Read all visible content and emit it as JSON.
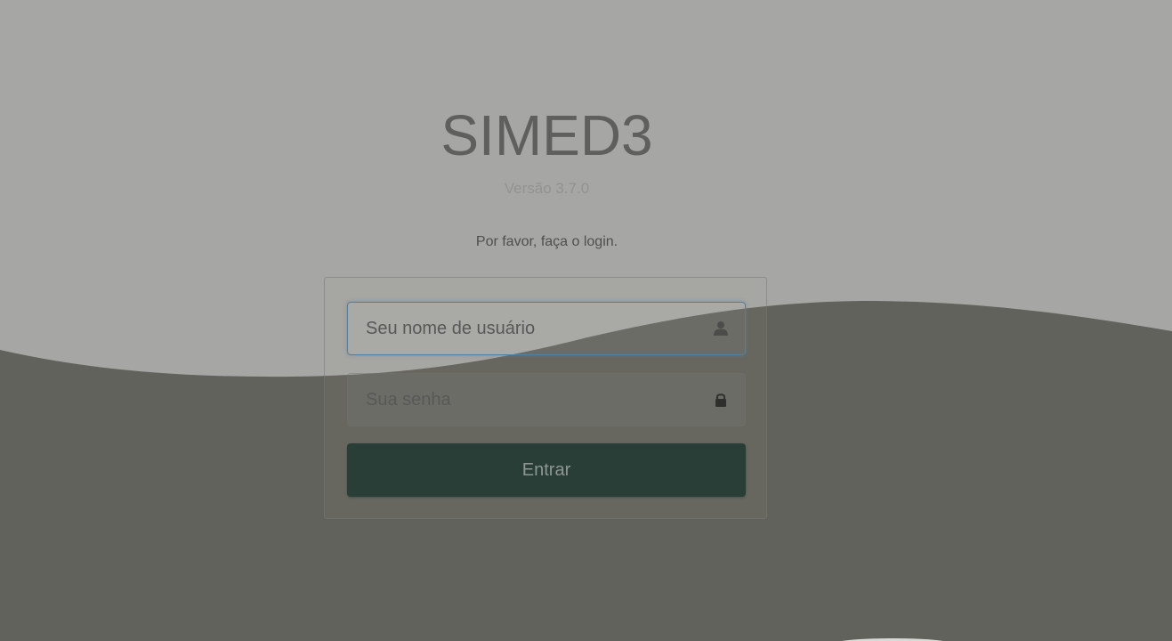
{
  "app": {
    "title": "SIMED3",
    "version": "Versão 3.7.0"
  },
  "login": {
    "prompt": "Por favor, faça o login.",
    "username_placeholder": "Seu nome de usuário",
    "password_placeholder": "Sua senha",
    "submit_label": "Entrar"
  },
  "icons": {
    "username": "user-icon",
    "password": "lock-icon"
  },
  "colors": {
    "background_top": "#a6a6a4",
    "background_wave": "#62625c",
    "button": "#2a3e38"
  }
}
